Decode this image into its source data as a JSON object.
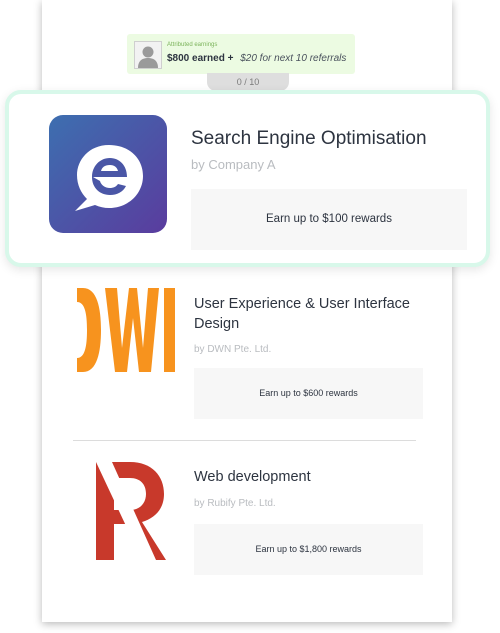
{
  "banner": {
    "caption": "Attributed earnings",
    "earned": "$800 earned +",
    "next": "$20 for next 10 referrals"
  },
  "progress": {
    "label": "0 / 10",
    "current": 0,
    "total": 10
  },
  "featured": {
    "title": "Search Engine Optimisation",
    "company": "by Company A",
    "reward": "Earn up to $100 rewards",
    "logo_icon": "e-speech-bubble-icon",
    "logo_colors": [
      "#3d6fb0",
      "#5a3c9e"
    ]
  },
  "items": [
    {
      "title": "User Experience & User Interface Design",
      "company": "by DWN Pte. Ltd.",
      "reward": "Earn up to $600 rewards",
      "logo_text": "DWN",
      "logo_color": "#f7931e"
    },
    {
      "title": "Web development",
      "company": "by Rubify Pte. Ltd.",
      "reward": "Earn up to $1,800 rewards",
      "logo_text": "R",
      "logo_color": "#c8392b"
    }
  ],
  "colors": {
    "highlight_border": "#d8f8ea",
    "banner_bg": "#ecfbe2",
    "reward_bg": "#f7f7f7"
  }
}
